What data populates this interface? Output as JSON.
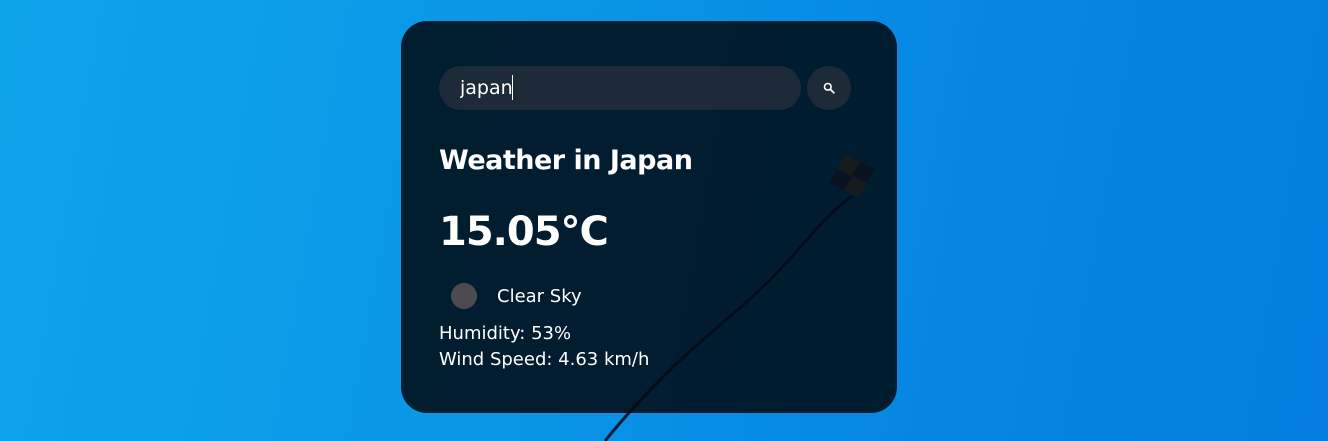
{
  "search": {
    "value": "japan",
    "button_icon": "search-icon"
  },
  "weather": {
    "city_title": "Weather in Japan",
    "temperature": "15.05°C",
    "icon": "weather-condition-icon",
    "description": "Clear Sky",
    "humidity": "Humidity: 53%",
    "wind_speed": "Wind Speed: 4.63 km/h"
  },
  "colors": {
    "background": "#0a96e6",
    "card": "#000c16",
    "input": "#1c2b37",
    "text": "#ffffff"
  }
}
